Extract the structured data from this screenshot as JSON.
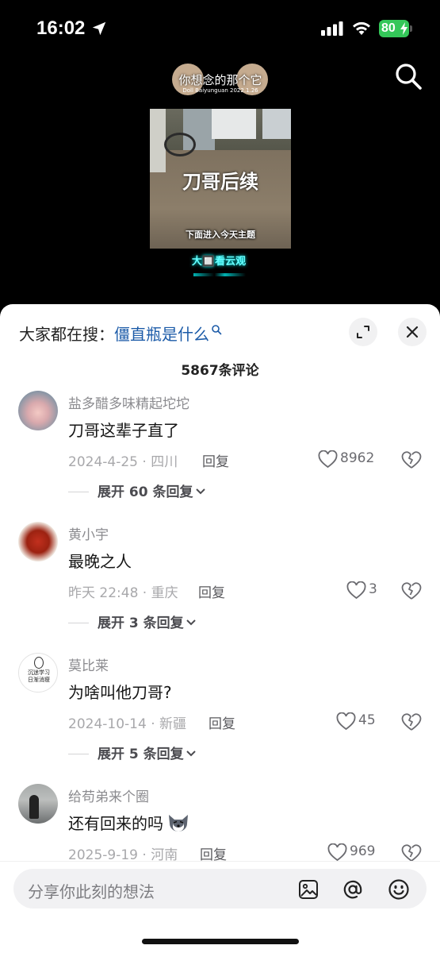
{
  "status_bar": {
    "time": "16:02",
    "battery": "80"
  },
  "video": {
    "watermark_title": "你想念的那个它",
    "watermark_sub": "Doll Baiyunguan 2022.1.26",
    "caption": "刀哥后续",
    "subtitle": "下面进入今天主题",
    "logo_text": "大🔲看云观"
  },
  "hot_search": {
    "prefix": "大家都在搜：",
    "keyword": "僵直瓶是什么"
  },
  "comment_count": "5867条评论",
  "comments": [
    {
      "name": "盐多醋多味精起坨坨",
      "text": "刀哥这辈子直了",
      "meta": "2024-4-25 · 四川",
      "reply": "回复",
      "likes": "8962",
      "expand": "展开 60 条回复"
    },
    {
      "name": "黄小宇",
      "text": "最晚之人",
      "meta": "昨天 22:48 · 重庆",
      "reply": "回复",
      "likes": "3",
      "expand": "展开 3 条回复"
    },
    {
      "name": "莫比莱",
      "text": "为啥叫他刀哥?",
      "meta": "2024-10-14 · 新疆",
      "reply": "回复",
      "likes": "45",
      "expand": "展开 5 条回复",
      "avatar_text": "沉迷学习\n日渐消瘦"
    },
    {
      "name": "给苟弟来个圈",
      "text": "还有回来的吗",
      "meta": "2025-9-19 · 河南",
      "reply": "回复",
      "likes": "969"
    }
  ],
  "input": {
    "placeholder": "分享你此刻的想法"
  },
  "colors": {
    "keyword_link": "#1c5ba8",
    "battery_green": "#34c759"
  }
}
